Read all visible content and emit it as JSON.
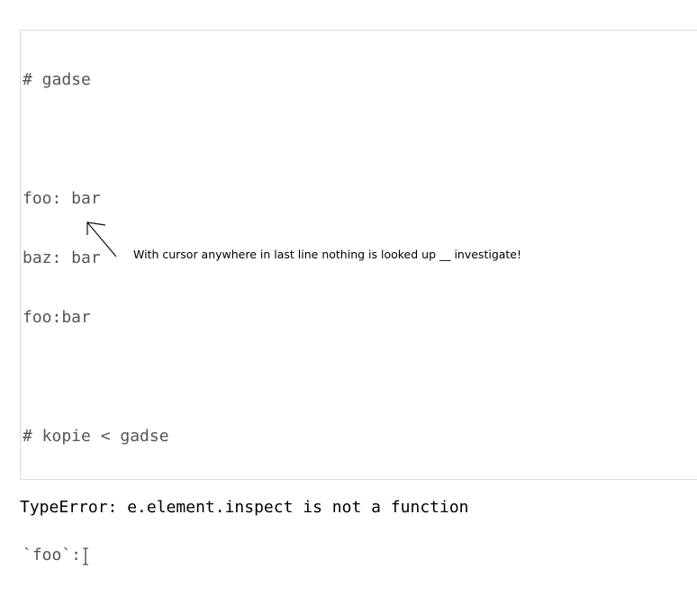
{
  "editor": {
    "lines": [
      "# gadse",
      "",
      "foo: bar",
      "baz: bar",
      "foo:bar",
      "",
      "# kopie < gadse",
      "",
      "`foo`:"
    ]
  },
  "annotation": {
    "text": "With cursor anywhere in last line nothing is looked up __ investigate!"
  },
  "error": {
    "message": "TypeError: e.element.inspect is not a function"
  },
  "colors": {
    "code_text": "#555555",
    "border": "#dcdcdc",
    "error_text": "#000000"
  },
  "icons": {
    "cursor": "text-cursor-icon",
    "arrow": "arrow-up-left-icon"
  }
}
